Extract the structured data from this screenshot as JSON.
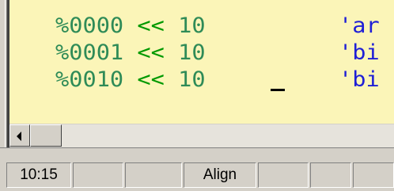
{
  "editor": {
    "lines": [
      {
        "number": "%0000",
        "op": "<<",
        "value": "10",
        "comment": "'ar"
      },
      {
        "number": "%0001",
        "op": "<<",
        "value": "10",
        "comment": "'bi"
      },
      {
        "number": "%0010",
        "op": "<<",
        "value": "10",
        "comment": "'bi"
      }
    ]
  },
  "statusbar": {
    "position": "10:15",
    "panel2": "",
    "panel3": "",
    "mode": "Align",
    "panel5": "",
    "panel6": "",
    "panel7": ""
  },
  "colors": {
    "editor_background": "#fbf5b8",
    "number": "#2e8b57",
    "operator": "#009900",
    "string": "#1f1fd6"
  },
  "icons": {
    "scroll_left": "left-arrow-icon"
  }
}
